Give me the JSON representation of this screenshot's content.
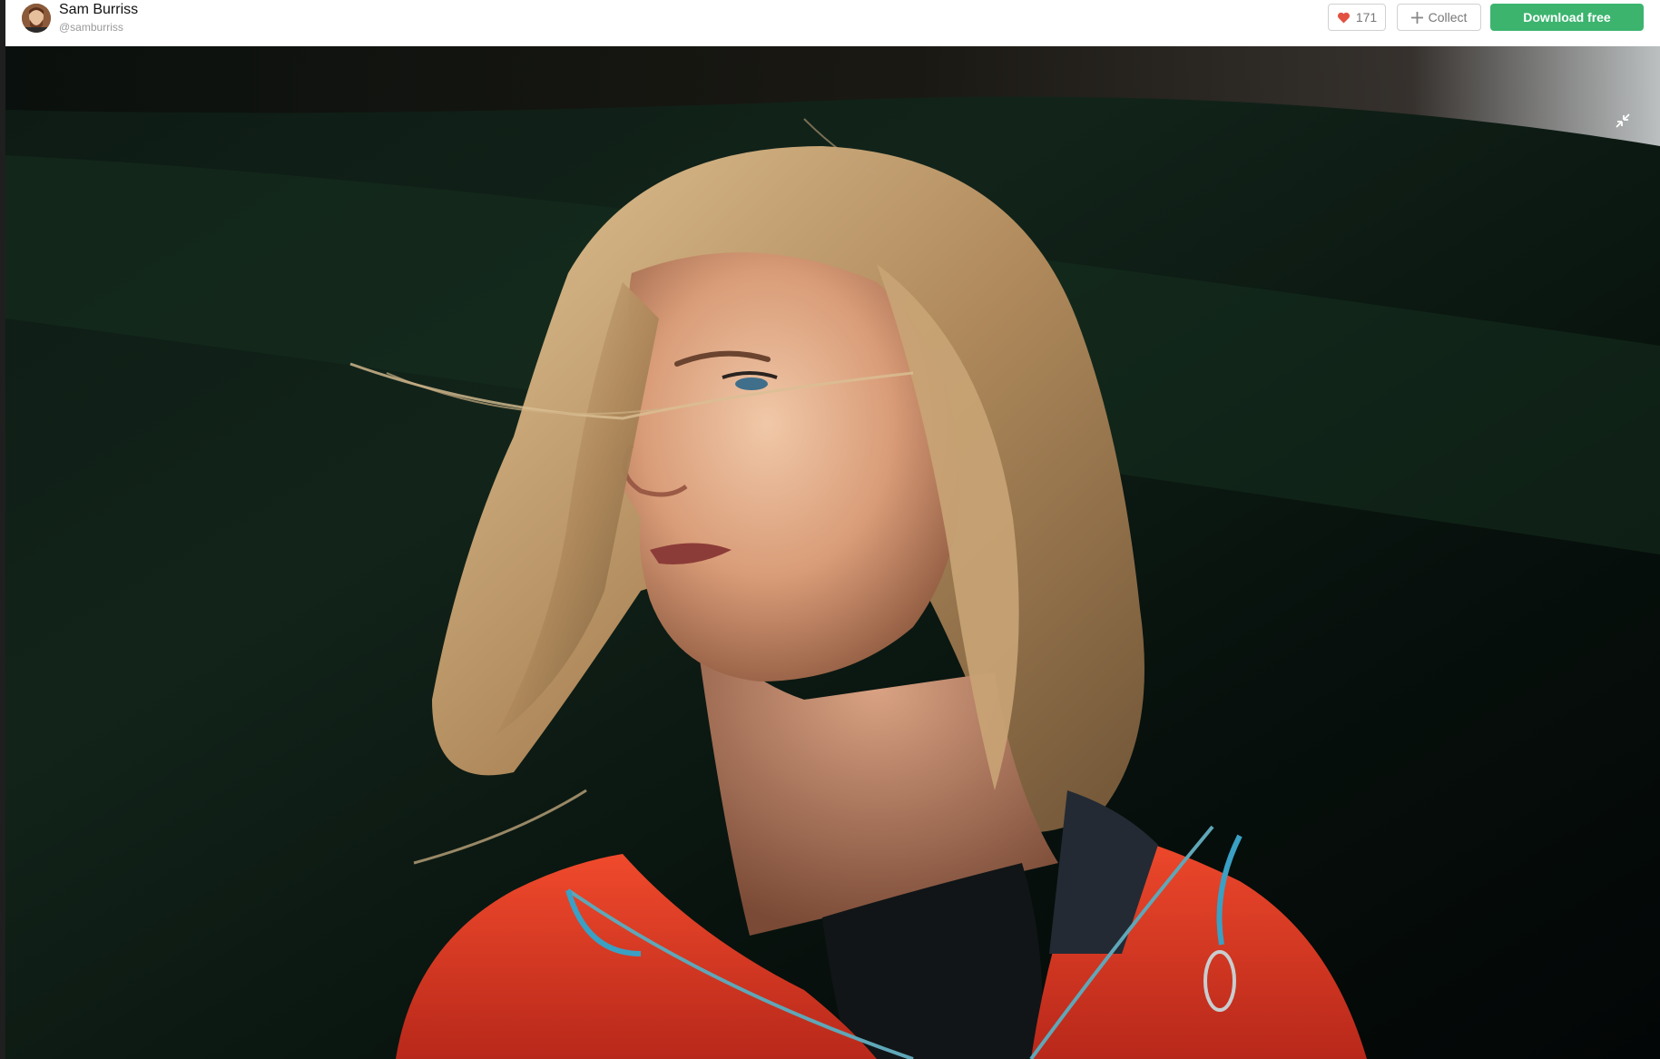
{
  "header": {
    "user_name": "Sam Burriss",
    "user_handle": "@samburriss",
    "like_count": "171",
    "collect_label": "Collect",
    "download_label": "Download free"
  },
  "icons": {
    "heart": "heart-icon",
    "plus": "plus-icon",
    "minimize": "minimize-icon"
  },
  "colors": {
    "download_green": "#3cb46e",
    "heart_red": "#e25142",
    "jacket_red": "#e0331e"
  }
}
